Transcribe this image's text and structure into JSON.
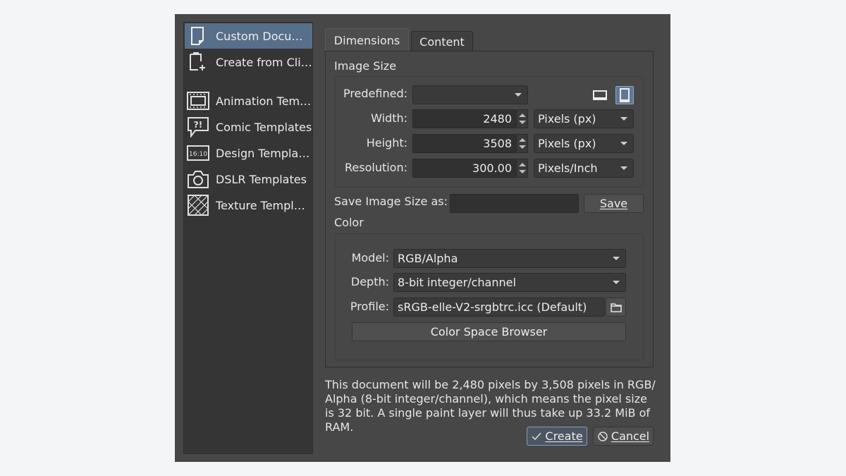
{
  "sidebar": {
    "items": [
      {
        "label": "Custom Docu…",
        "icon": "document-icon",
        "selected": true
      },
      {
        "label": "Create from Cli…",
        "icon": "clipboard-new-icon"
      },
      {
        "label": "Animation Tem…",
        "icon": "film-icon"
      },
      {
        "label": "Comic Templates",
        "icon": "speech-bubble-icon"
      },
      {
        "label": "Design Templa…",
        "icon": "ratio-icon",
        "icon_text": "16:10"
      },
      {
        "label": "DSLR Templates",
        "icon": "camera-icon"
      },
      {
        "label": "Texture Templ…",
        "icon": "texture-icon"
      }
    ]
  },
  "tabs": [
    {
      "label": "Dimensions",
      "active": true
    },
    {
      "label": "Content",
      "active": false
    }
  ],
  "image_size": {
    "title": "Image Size",
    "predefined_label": "Predefined:",
    "predefined_value": "",
    "width_label": "Width:",
    "width_value": "2480",
    "width_unit": "Pixels (px)",
    "height_label": "Height:",
    "height_value": "3508",
    "height_unit": "Pixels (px)",
    "resolution_label": "Resolution:",
    "resolution_value": "300.00",
    "resolution_unit": "Pixels/Inch",
    "save_as_label": "Save Image Size as:",
    "save_as_value": "",
    "save_button": "Save"
  },
  "color": {
    "title": "Color",
    "model_label": "Model:",
    "model_value": "RGB/Alpha",
    "depth_label": "Depth:",
    "depth_value": "8-bit integer/channel",
    "profile_label": "Profile:",
    "profile_value": "sRGB-elle-V2-srgbtrc.icc (Default)",
    "browser_button": "Color Space Browser"
  },
  "summary": "This document will be 2,480 pixels by 3,508 pixels in RGB/ Alpha (8-bit integer/channel), which means the pixel size is 32 bit. A single paint layer will thus take up 33.2 MiB of RAM.",
  "footer": {
    "create": "Create",
    "cancel": "Cancel"
  },
  "colors": {
    "dialog_bg": "#474747",
    "sidebar_bg": "#353535",
    "selection": "#586f8a",
    "text": "#e6e6e6"
  }
}
